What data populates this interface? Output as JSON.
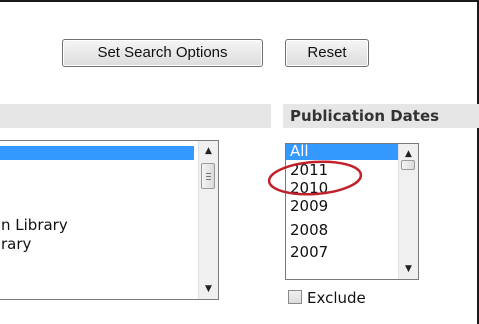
{
  "buttons": {
    "set_search_options": "Set Search Options",
    "reset": "Reset"
  },
  "publication_dates": {
    "header": "Publication Dates",
    "options": [
      "All",
      "2011",
      "2010",
      "2009",
      "2008",
      "2007"
    ],
    "selected": "All",
    "exclude_label": "Exclude"
  },
  "left_list": {
    "visible_fragments": [
      "n Library",
      "rary"
    ]
  },
  "colors": {
    "selection": "#3399ff",
    "header_bg": "#e6e6e6",
    "annotation": "#c0212b"
  },
  "icons": [
    "scroll-up-icon",
    "scroll-down-icon",
    "checkbox-icon"
  ]
}
